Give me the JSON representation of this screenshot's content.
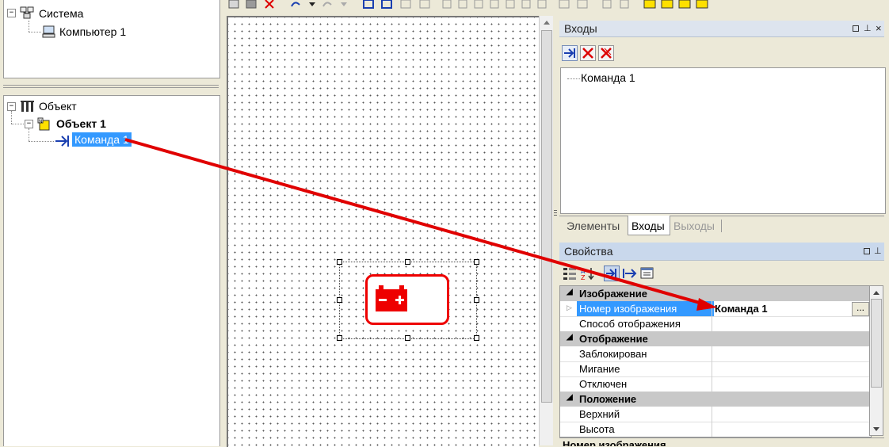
{
  "system_tree": {
    "root_label": "Система",
    "child_label": "Компьютер 1"
  },
  "object_tree": {
    "root_label": "Объект",
    "object_label": "Объект 1",
    "command_label": "Команда 1"
  },
  "inputs_panel": {
    "title": "Входы",
    "items": [
      "Команда 1"
    ]
  },
  "tabs": [
    {
      "label": "Элементы",
      "active": false,
      "disabled": false
    },
    {
      "label": "Входы",
      "active": true,
      "disabled": false
    },
    {
      "label": "Выходы",
      "active": false,
      "disabled": true
    }
  ],
  "properties_panel": {
    "title": "Свойства",
    "ellipsis": "...",
    "rows": [
      {
        "type": "category",
        "name": "Изображение"
      },
      {
        "type": "prop",
        "name": "Номер изображения",
        "value": "Команда 1",
        "selected": true
      },
      {
        "type": "prop",
        "name": "Способ отображения",
        "value": ""
      },
      {
        "type": "category",
        "name": "Отображение"
      },
      {
        "type": "prop",
        "name": "Заблокирован",
        "value": ""
      },
      {
        "type": "prop",
        "name": "Мигание",
        "value": ""
      },
      {
        "type": "prop",
        "name": "Отключен",
        "value": ""
      },
      {
        "type": "category",
        "name": "Положение"
      },
      {
        "type": "prop",
        "name": "Верхний",
        "value": ""
      },
      {
        "type": "prop",
        "name": "Высота",
        "value": ""
      }
    ],
    "description_title": "Номер изображения"
  },
  "colors": {
    "selection": "#3399ff",
    "arrow": "#e00000",
    "panel_header": "#dde4ee",
    "category_bg": "#c8c8c8"
  }
}
